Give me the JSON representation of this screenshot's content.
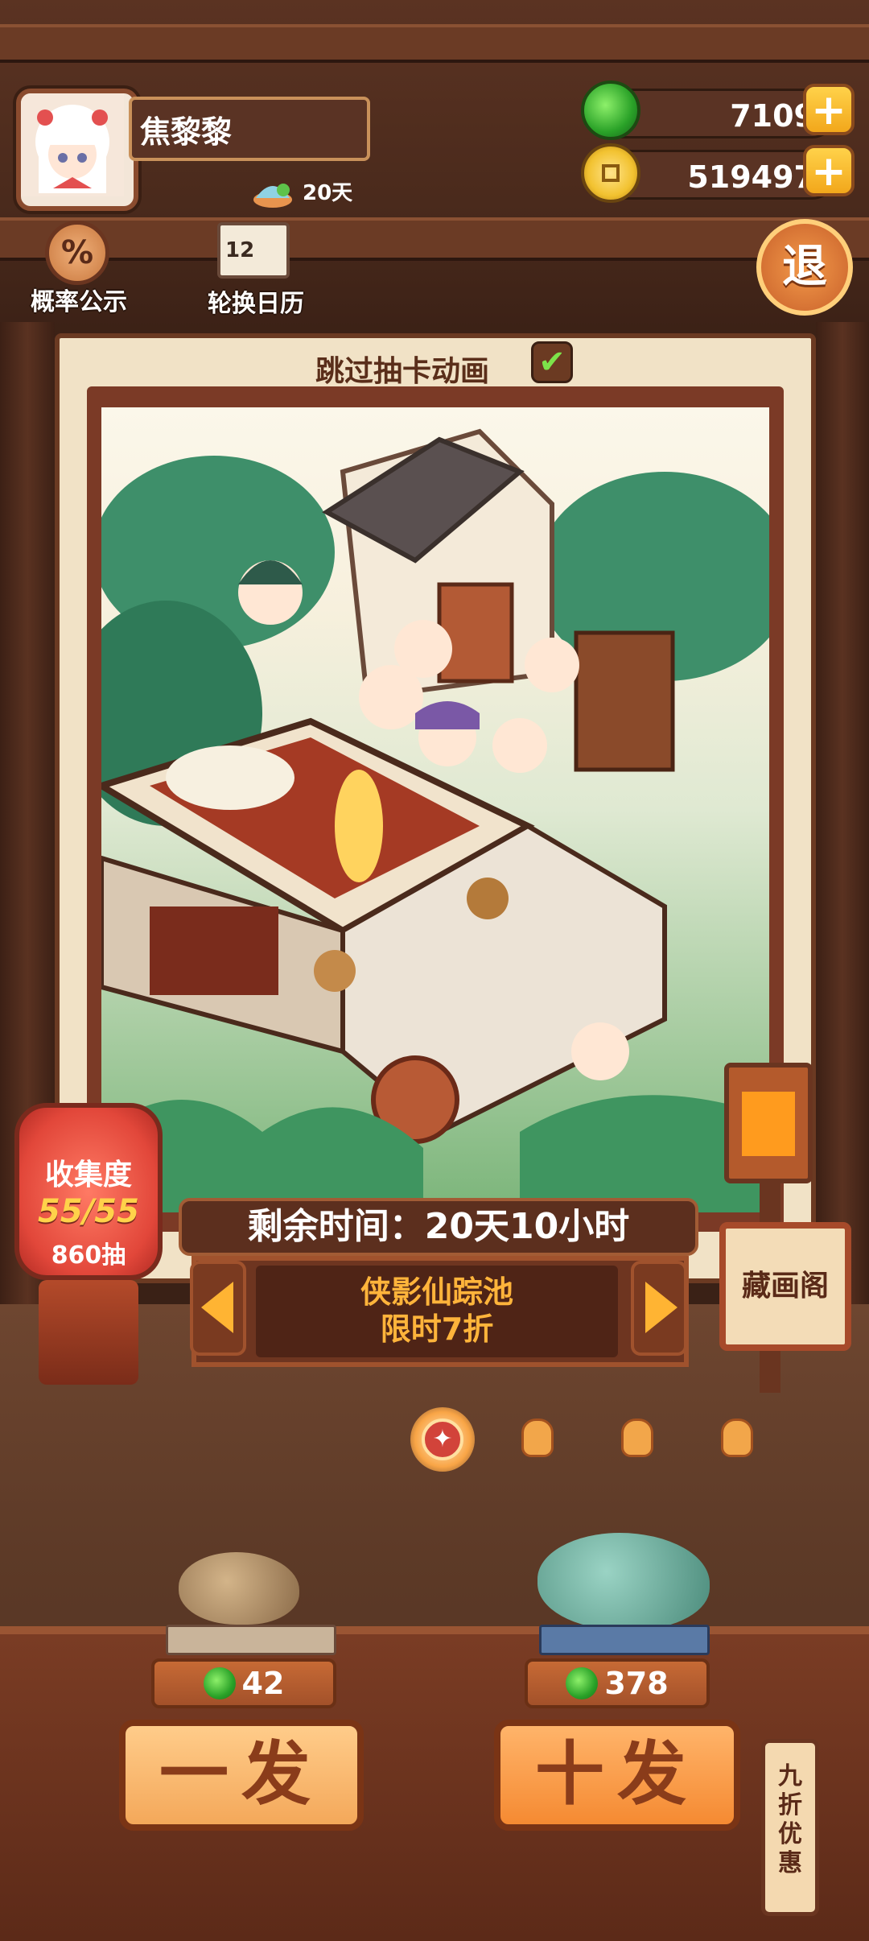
{
  "player": {
    "name": "焦黎黎",
    "days": "20天"
  },
  "currency": {
    "jade": "7109",
    "coins": "519497",
    "plus": "+"
  },
  "side_menu": {
    "probability_label": "概率公示",
    "probability_icon_text": "%",
    "calendar_label": "轮换日历",
    "calendar_icon_text": "12",
    "exit_label": "退"
  },
  "draw": {
    "skip_animation_label": "跳过抽卡动画",
    "skip_animation_checked": true,
    "remaining_time": "剩余时间：20天10小时",
    "pool_name": "侠影仙踪池",
    "pool_offer": "限时7折"
  },
  "collection": {
    "title": "收集度",
    "progress": "55/55",
    "pulls": "860抽"
  },
  "gallery": {
    "label": "藏画阁"
  },
  "pagination": {
    "total": 4,
    "active_index": 0
  },
  "pull_options": {
    "single": {
      "cost": "42",
      "label": "一发"
    },
    "ten": {
      "cost": "378",
      "label": "十发"
    },
    "discount_tag": "九折优惠"
  },
  "colors": {
    "accent_orange": "#f4a85a",
    "jade_green": "#2aa228",
    "coin_gold": "#f2c230",
    "pool_text": "#ffb43b"
  }
}
